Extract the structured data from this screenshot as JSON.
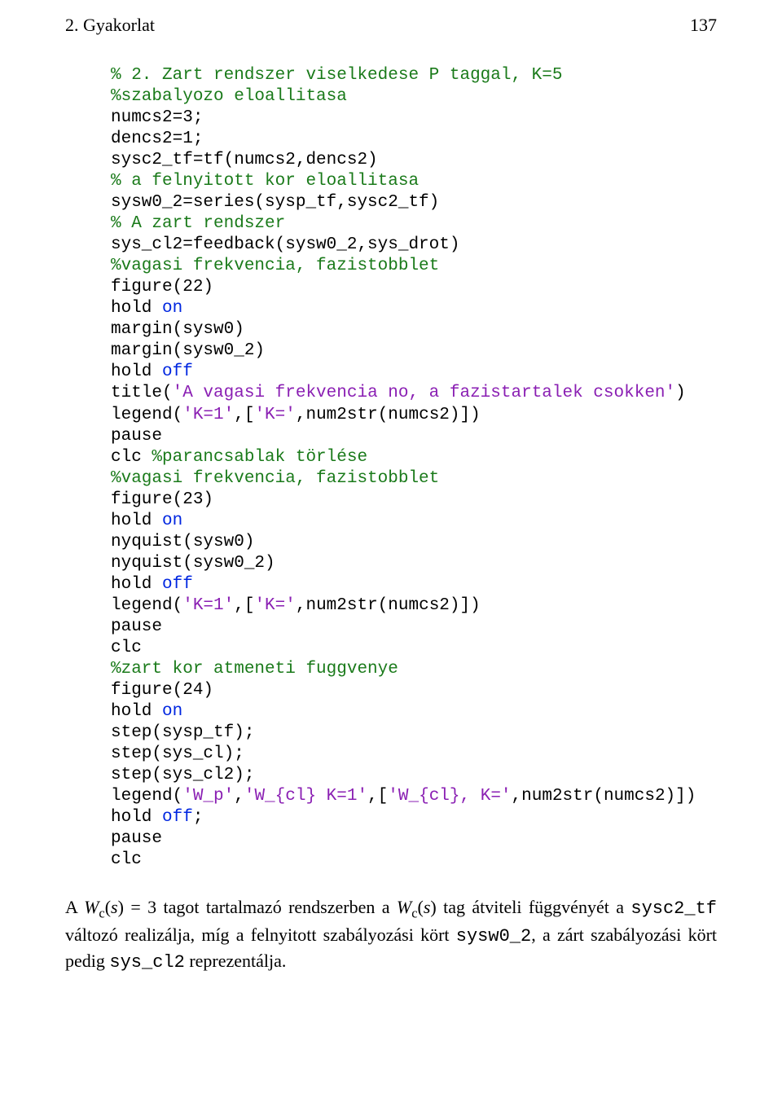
{
  "header": {
    "title": "2. Gyakorlat",
    "page": "137"
  },
  "code": {
    "l1": "% 2. Zart rendszer viselkedese P taggal, K=5",
    "l2": "%szabalyozo eloallitasa",
    "l3": "numcs2=3;",
    "l4": "dencs2=1;",
    "l5": "sysc2_tf=tf(numcs2,dencs2)",
    "l6": "% a felnyitott kor eloallitasa",
    "l7": "sysw0_2=series(sysp_tf,sysc2_tf)",
    "l8": "% A zart rendszer",
    "l9": "sys_cl2=feedback(sysw0_2,sys_drot)",
    "l10": "%vagasi frekvencia, fazistobblet",
    "l11": "figure(22)",
    "l12a": "hold ",
    "l12b": "on",
    "l13": "margin(sysw0)",
    "l14": "margin(sysw0_2)",
    "l15a": "hold ",
    "l15b": "off",
    "l16a": "title(",
    "l16b": "'A vagasi frekvencia no, a fazistartalek csokken'",
    "l16c": ")",
    "l17a": "legend(",
    "l17b": "'K=1'",
    "l17c": ",[",
    "l17d": "'K='",
    "l17e": ",num2str(numcs2)])",
    "l18": "pause",
    "l19a": "clc ",
    "l19b": "%parancsablak törlése",
    "l20": "%vagasi frekvencia, fazistobblet",
    "l21": "figure(23)",
    "l22a": "hold ",
    "l22b": "on",
    "l23": "nyquist(sysw0)",
    "l24": "nyquist(sysw0_2)",
    "l25a": "hold ",
    "l25b": "off",
    "l26a": "legend(",
    "l26b": "'K=1'",
    "l26c": ",[",
    "l26d": "'K='",
    "l26e": ",num2str(numcs2)])",
    "l27": "pause",
    "l28": "clc",
    "l29": "%zart kor atmeneti fuggvenye",
    "l30": "figure(24)",
    "l31a": "hold ",
    "l31b": "on",
    "l32": "step(sysp_tf);",
    "l33": "step(sys_cl);",
    "l34": "step(sys_cl2);",
    "l35a": "legend(",
    "l35b": "'W_p'",
    "l35c": ",",
    "l35d": "'W_{cl} K=1'",
    "l35e": ",[",
    "l35f": "'W_{cl}, K='",
    "l35g": ",num2str(numcs2)])",
    "l36a": "hold ",
    "l36b": "off",
    "l36c": ";",
    "l37": "pause",
    "l38": "clc"
  },
  "paragraph": {
    "p1a": "A  ",
    "p1b": "W",
    "p1c": "c",
    "p1d": "(",
    "p1e": "s",
    "p1f": ") = 3",
    "p1g": "  tagot  tartalmazó  rendszerben  a  ",
    "p1h": "W",
    "p1i": "c",
    "p1j": "(",
    "p1k": "s",
    "p1l": ")",
    "p1m": "  tag  átviteli  függvényét  a",
    "p2a": "sysc2_tf",
    "p2b": " változó realizálja, míg a felnyitott szabályozási kört ",
    "p2c": "sysw0_2",
    "p2d": ", a zárt",
    "p3a": "szabályozási kört pedig ",
    "p3b": "sys_cl2",
    "p3c": "  reprezentálja."
  }
}
